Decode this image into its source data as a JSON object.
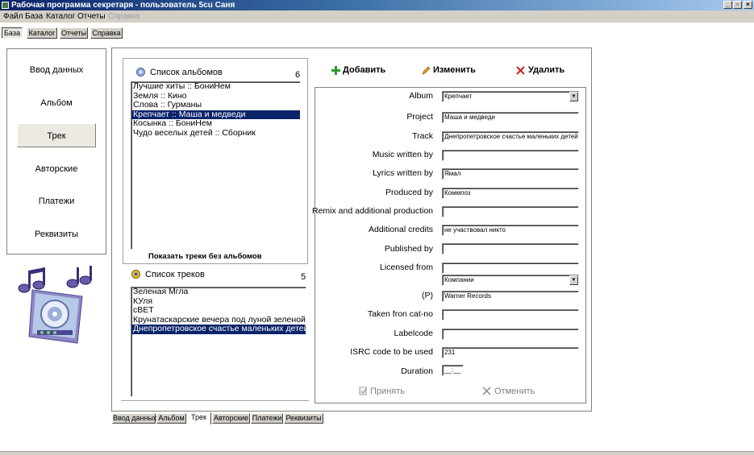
{
  "window": {
    "title": "Рабочая программа секретаря - пользователь 5cu Саня",
    "controls": {
      "minimize": "_",
      "maximize": "▫",
      "close": "×"
    }
  },
  "menu": [
    "Файл",
    "База",
    "Каталог",
    "Отчеты",
    "Справка"
  ],
  "toolbar": [
    "База",
    "Каталог",
    "Отчеты",
    "Справка"
  ],
  "nav": [
    "Ввод данных",
    "Альбом",
    "Трек",
    "Авторские",
    "Платежи",
    "Реквизиты"
  ],
  "albums": {
    "title": "Список альбомов",
    "count": "6",
    "items": [
      "Лучшие хиты :: БониНем",
      "Земля :: Кино",
      "Слова :: Гурманы",
      "Крепчает :: Маша и медведи",
      "Косынка :: БониНем",
      "Чудо веселых детей :: Сборник"
    ],
    "show_tracks_label": "Показать треки без альбомов"
  },
  "tracks": {
    "title": "Список треков",
    "count": "5",
    "items": [
      "Зеленая Мгла",
      "КУля",
      "сВЕТ",
      "Крунатаскарские вечера под луной зеленой",
      "Днепропетровское счастье маленьких детей"
    ]
  },
  "actions": {
    "add": "Добавить",
    "edit": "Изменить",
    "delete": "Удалить"
  },
  "form": {
    "album": {
      "label": "Album",
      "value": "Крепчает"
    },
    "project": {
      "label": "Project",
      "value": "Маша и медведи"
    },
    "track": {
      "label": "Track",
      "value": "Днепропетровское счастье маленьких детей"
    },
    "music": {
      "label": "Music written by",
      "value": ""
    },
    "lyrics": {
      "label": "Lyrics written by",
      "value": "Ямал"
    },
    "produced": {
      "label": "Produced by",
      "value": "Коммпоз"
    },
    "remix": {
      "label": "Remix and additional production",
      "value": ""
    },
    "credits": {
      "label": "Additional credits",
      "value": "не участвовал никто"
    },
    "published": {
      "label": "Published by",
      "value": ""
    },
    "licensed": {
      "label": "Licensed from",
      "value": ""
    },
    "companies": {
      "value": "Компании"
    },
    "p": {
      "label": "(P)",
      "value": "Warner Records"
    },
    "catno": {
      "label": "Taken fron cat-no",
      "value": ""
    },
    "labelcode": {
      "label": "Labelcode",
      "value": ""
    },
    "isrc": {
      "label": "ISRC code to be used",
      "value": "231"
    },
    "duration": {
      "label": "Duration",
      "value": "__:__"
    }
  },
  "form_buttons": {
    "accept": "Принять",
    "cancel": "Отменить"
  },
  "bottom_tabs": [
    "Ввод данных",
    "Альбом",
    "Трек",
    "Авторские",
    "Платежи",
    "Реквизиты"
  ],
  "colors": {
    "selection": "#0a246a",
    "add_icon": "#2e9a2e",
    "delete_icon": "#cc2222",
    "edit_icon": "#d89a20"
  }
}
